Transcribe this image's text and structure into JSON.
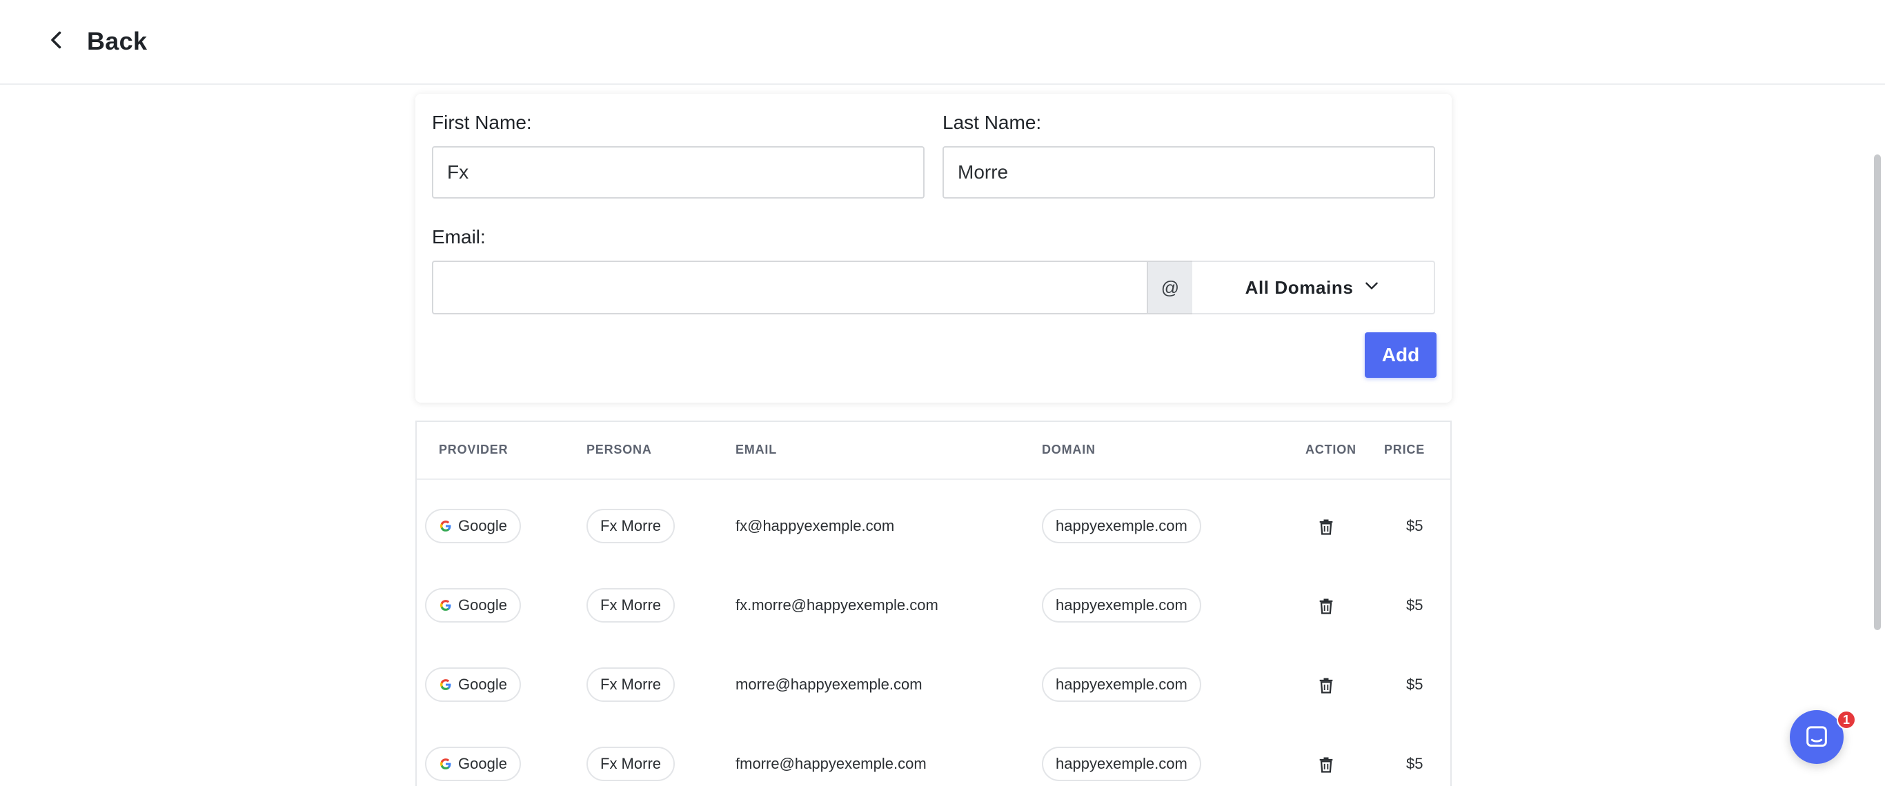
{
  "header": {
    "back_label": "Back"
  },
  "form": {
    "first_name_label": "First Name:",
    "first_name_value": "Fx",
    "last_name_label": "Last Name:",
    "last_name_value": "Morre",
    "email_label": "Email:",
    "email_value": "",
    "at_symbol": "@",
    "domain_select_value": "All Domains",
    "add_button_label": "Add"
  },
  "table": {
    "columns": {
      "provider": "PROVIDER",
      "persona": "PERSONA",
      "email": "EMAIL",
      "domain": "DOMAIN",
      "action": "ACTION",
      "price": "PRICE"
    },
    "rows": [
      {
        "provider": "Google",
        "persona": "Fx Morre",
        "email": "fx@happyexemple.com",
        "domain": "happyexemple.com",
        "price": "$5"
      },
      {
        "provider": "Google",
        "persona": "Fx Morre",
        "email": "fx.morre@happyexemple.com",
        "domain": "happyexemple.com",
        "price": "$5"
      },
      {
        "provider": "Google",
        "persona": "Fx Morre",
        "email": "morre@happyexemple.com",
        "domain": "happyexemple.com",
        "price": "$5"
      },
      {
        "provider": "Google",
        "persona": "Fx Morre",
        "email": "fmorre@happyexemple.com",
        "domain": "happyexemple.com",
        "price": "$5"
      }
    ]
  },
  "chat": {
    "badge_count": "1"
  },
  "colors": {
    "accent": "#4f6af2",
    "badge": "#e5383b"
  },
  "icons": {
    "back": "chevron-left-icon",
    "domain_dropdown": "chevron-down-icon",
    "provider": "google-icon",
    "action": "trash-icon",
    "chat": "chat-icon"
  }
}
